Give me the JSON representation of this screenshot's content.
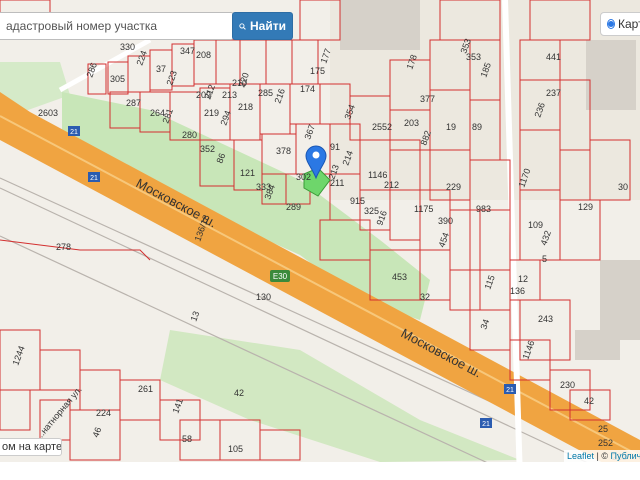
{
  "search": {
    "placeholder": "адастровый номер участка",
    "button_label": "Найти"
  },
  "layers": {
    "map_label": "Карт"
  },
  "bottom_question": "ом на карте?",
  "attribution": {
    "leaflet": "Leaflet",
    "separator": " | © ",
    "source": "Публичн"
  },
  "roads": {
    "moskovskoe_1": "Московское ш.",
    "moskovskoe_2": "Московское ш.",
    "e30": "E30",
    "ulitsa": "...натнорная ул."
  },
  "shields": [
    "21",
    "21",
    "21",
    "21"
  ],
  "colors": {
    "parcel_border": "#d32f2f",
    "green_area": "#c8e6b8",
    "highway": "#f0a441",
    "selected": "#6ed66b",
    "marker": "#2b78e4",
    "button": "#337ab7"
  },
  "parcel_labels": [
    "286",
    "305",
    "330",
    "224",
    "37",
    "347",
    "223",
    "208",
    "209",
    "212",
    "213",
    "210",
    "220",
    "287",
    "264",
    "281",
    "280",
    "219",
    "294",
    "218",
    "285",
    "216",
    "174",
    "175",
    "177",
    "2603",
    "352",
    "86",
    "121",
    "333",
    "384",
    "289",
    "378",
    "367",
    "302",
    "91",
    "214",
    "1146",
    "212",
    "213",
    "915",
    "325",
    "916",
    "1175",
    "390",
    "454",
    "453",
    "278",
    "136/18",
    "130",
    "211",
    "354",
    "2552",
    "203",
    "882",
    "19",
    "89",
    "178",
    "377",
    "353",
    "185",
    "441",
    "237",
    "236",
    "229",
    "983",
    "1170",
    "109",
    "129",
    "432",
    "5",
    "12",
    "115",
    "136",
    "243",
    "1146",
    "230",
    "42",
    "1244",
    "261",
    "224",
    "46",
    "58",
    "105",
    "13",
    "233",
    "42",
    "141",
    "25",
    "252",
    "34",
    "30",
    "32",
    "353"
  ]
}
